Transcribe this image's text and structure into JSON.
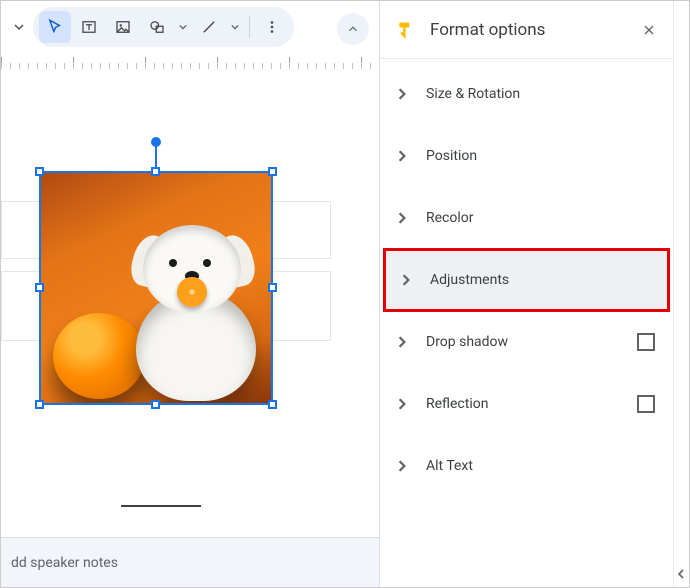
{
  "toolbar": {
    "tools": [
      "select",
      "textbox",
      "image",
      "shape",
      "line"
    ],
    "more_label": "more"
  },
  "panel": {
    "title": "Format options",
    "sections": [
      {
        "label": "Size & Rotation",
        "checkbox": false
      },
      {
        "label": "Position",
        "checkbox": false
      },
      {
        "label": "Recolor",
        "checkbox": false
      },
      {
        "label": "Adjustments",
        "checkbox": false,
        "highlight": true
      },
      {
        "label": "Drop shadow",
        "checkbox": true,
        "checked": false
      },
      {
        "label": "Reflection",
        "checkbox": true,
        "checked": false
      },
      {
        "label": "Alt Text",
        "checkbox": false
      }
    ]
  },
  "speaker_notes_placeholder": "dd speaker notes",
  "selected_image": {
    "description": "A small white fluffy dog sitting against an orange backdrop, holding an orange slice in its mouth, with a whole orange in front of it."
  }
}
